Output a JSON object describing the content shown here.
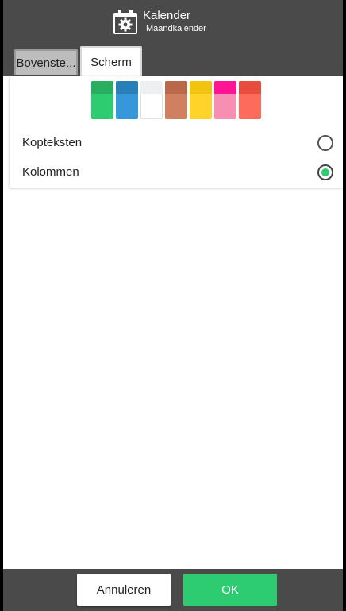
{
  "header": {
    "title": "Kalender",
    "subtitle": "Maandkalender",
    "icon": "calendar-settings-icon"
  },
  "tabs": [
    {
      "label": "Bovenste...",
      "active": false
    },
    {
      "label": "Scherm",
      "active": true
    }
  ],
  "swatches": [
    {
      "name": "green",
      "top": "#27ae60",
      "bottom": "#2ecc71"
    },
    {
      "name": "blue",
      "top": "#2980b9",
      "bottom": "#3498db"
    },
    {
      "name": "white",
      "top": "#ecf0f1",
      "bottom": "#ffffff"
    },
    {
      "name": "brown",
      "top": "#b9694a",
      "bottom": "#d08060"
    },
    {
      "name": "yellow",
      "top": "#f1c40f",
      "bottom": "#ffd32a"
    },
    {
      "name": "pink",
      "top": "#ff1493",
      "bottom": "#f78fb3"
    },
    {
      "name": "red",
      "top": "#e74c3c",
      "bottom": "#ff6b5a"
    }
  ],
  "options": [
    {
      "label": "Kopteksten",
      "selected": false
    },
    {
      "label": "Kolommen",
      "selected": true
    }
  ],
  "buttons": {
    "cancel_label": "Annuleren",
    "ok_label": "OK"
  },
  "colors": {
    "bar": "#4a4a4a",
    "accent": "#2ecc71"
  }
}
